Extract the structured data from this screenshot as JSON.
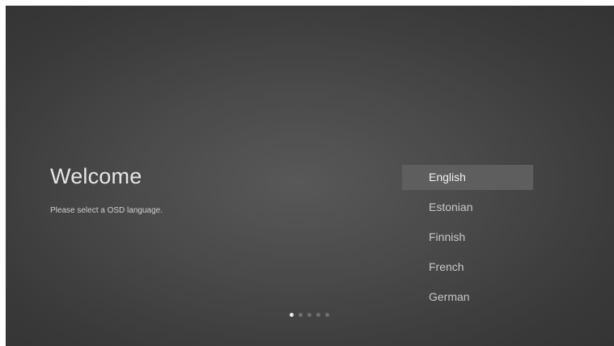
{
  "welcome": {
    "title": "Welcome",
    "subtitle": "Please select a OSD language."
  },
  "languages": {
    "items": [
      {
        "label": "English",
        "selected": true
      },
      {
        "label": "Estonian",
        "selected": false
      },
      {
        "label": "Finnish",
        "selected": false
      },
      {
        "label": "French",
        "selected": false
      },
      {
        "label": "German",
        "selected": false
      }
    ]
  },
  "pagination": {
    "total": 5,
    "current": 1
  },
  "colors": {
    "background": "#4a4a4a",
    "selected_highlight": "#5e5e5e",
    "text_primary": "#e6e6e6",
    "dot_active": "#e8e8e8",
    "dot_inactive": "#6f6f6f"
  }
}
